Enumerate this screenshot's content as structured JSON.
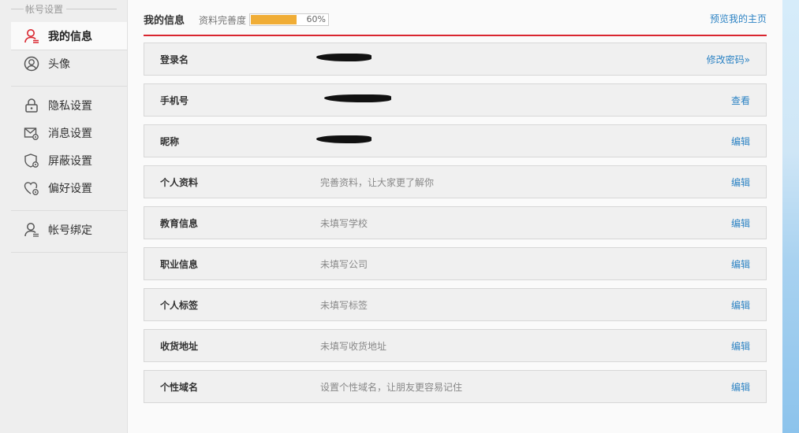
{
  "sidebar": {
    "section_title": "帐号设置",
    "items": [
      {
        "label": "我的信息",
        "icon": "user-icon"
      },
      {
        "label": "头像",
        "icon": "avatar-icon"
      },
      {
        "label": "隐私设置",
        "icon": "lock-icon"
      },
      {
        "label": "消息设置",
        "icon": "mail-settings-icon"
      },
      {
        "label": "屏蔽设置",
        "icon": "shield-settings-icon"
      },
      {
        "label": "偏好设置",
        "icon": "heart-settings-icon"
      },
      {
        "label": "帐号绑定",
        "icon": "user-bind-icon"
      }
    ]
  },
  "header": {
    "title": "我的信息",
    "completion_label": "资料完善度",
    "completion_percent": 60,
    "completion_text": "60%",
    "preview_link": "预览我的主页"
  },
  "rows": [
    {
      "label": "登录名",
      "value": "",
      "action": "修改密码»"
    },
    {
      "label": "手机号",
      "value": "",
      "action": "查看"
    },
    {
      "label": "昵称",
      "value": "",
      "action": "编辑"
    },
    {
      "label": "个人资料",
      "value": "完善资料，让大家更了解你",
      "action": "编辑"
    },
    {
      "label": "教育信息",
      "value": "未填写学校",
      "action": "编辑"
    },
    {
      "label": "职业信息",
      "value": "未填写公司",
      "action": "编辑"
    },
    {
      "label": "个人标签",
      "value": "未填写标签",
      "action": "编辑"
    },
    {
      "label": "收货地址",
      "value": "未填写收货地址",
      "action": "编辑"
    },
    {
      "label": "个性域名",
      "value": "设置个性域名，让朋友更容易记住",
      "action": "编辑"
    }
  ],
  "colors": {
    "accent_red": "#d9262f",
    "link_blue": "#2d83c4",
    "progress_orange": "#f0ad36"
  }
}
